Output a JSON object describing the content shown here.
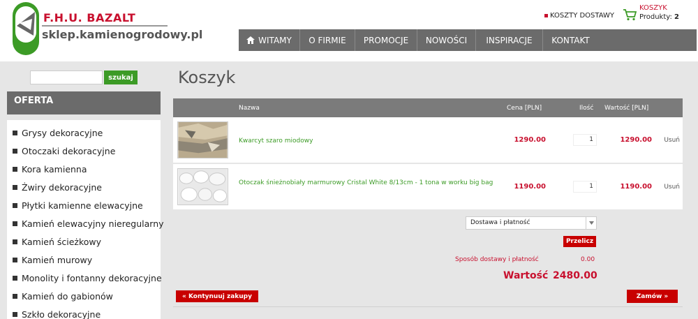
{
  "brand": {
    "name": "F.H.U. BAZALT",
    "domain": "sklep.kamienogrodowy.pl"
  },
  "header": {
    "shipping_costs": "KOSZTY DOSTAWY",
    "cart_title": "KOSZYK",
    "cart_products_label": "Produkty:",
    "cart_products_count": "2"
  },
  "nav": [
    "WITAMY",
    "O FIRMIE",
    "PROMOCJE",
    "NOWOŚCI",
    "INSPIRACJE",
    "KONTAKT"
  ],
  "search": {
    "button": "szukaj",
    "value": ""
  },
  "sidebar": {
    "title": "OFERTA",
    "items": [
      "Grysy dekoracyjne",
      "Otoczaki dekoracyjne",
      "Kora kamienna",
      "Żwiry dekoracyjne",
      "Płytki kamienne elewacyjne",
      "Kamień elewacyjny nieregularny",
      "Kamień ścieżkowy",
      "Kamień murowy",
      "Monolity i fontanny dekoracyjne",
      "Kamień do gabionów",
      "Szkło dekoracyjne"
    ]
  },
  "page_title": "Koszyk",
  "table": {
    "headers": {
      "name": "Nazwa",
      "price": "Cena [PLN]",
      "qty": "Ilość",
      "total": "Wartość [PLN]"
    },
    "rows": [
      {
        "name": "Kwarcyt szaro miodowy",
        "price": "1290.00",
        "qty": "1",
        "total": "1290.00",
        "remove": "Usuń"
      },
      {
        "name": "Otoczak śnieżnobiały marmurowy Cristal White 8/13cm - 1 tona w worku big bag",
        "price": "1190.00",
        "qty": "1",
        "total": "1190.00",
        "remove": "Usuń"
      }
    ]
  },
  "shipping_select": {
    "value": "Dostawa i płatność"
  },
  "recalc": "Przelicz",
  "delivery": {
    "label": "Sposób dostawy i płatność",
    "value": "0.00"
  },
  "summary": {
    "label": "Wartość",
    "value": "2480.00"
  },
  "continue": "« Kontynuuj zakupy",
  "order": "Zamów »",
  "colors": {
    "accent_red": "#c8102e",
    "green": "#3c9b26",
    "nav_gray": "#6b6b6b"
  }
}
